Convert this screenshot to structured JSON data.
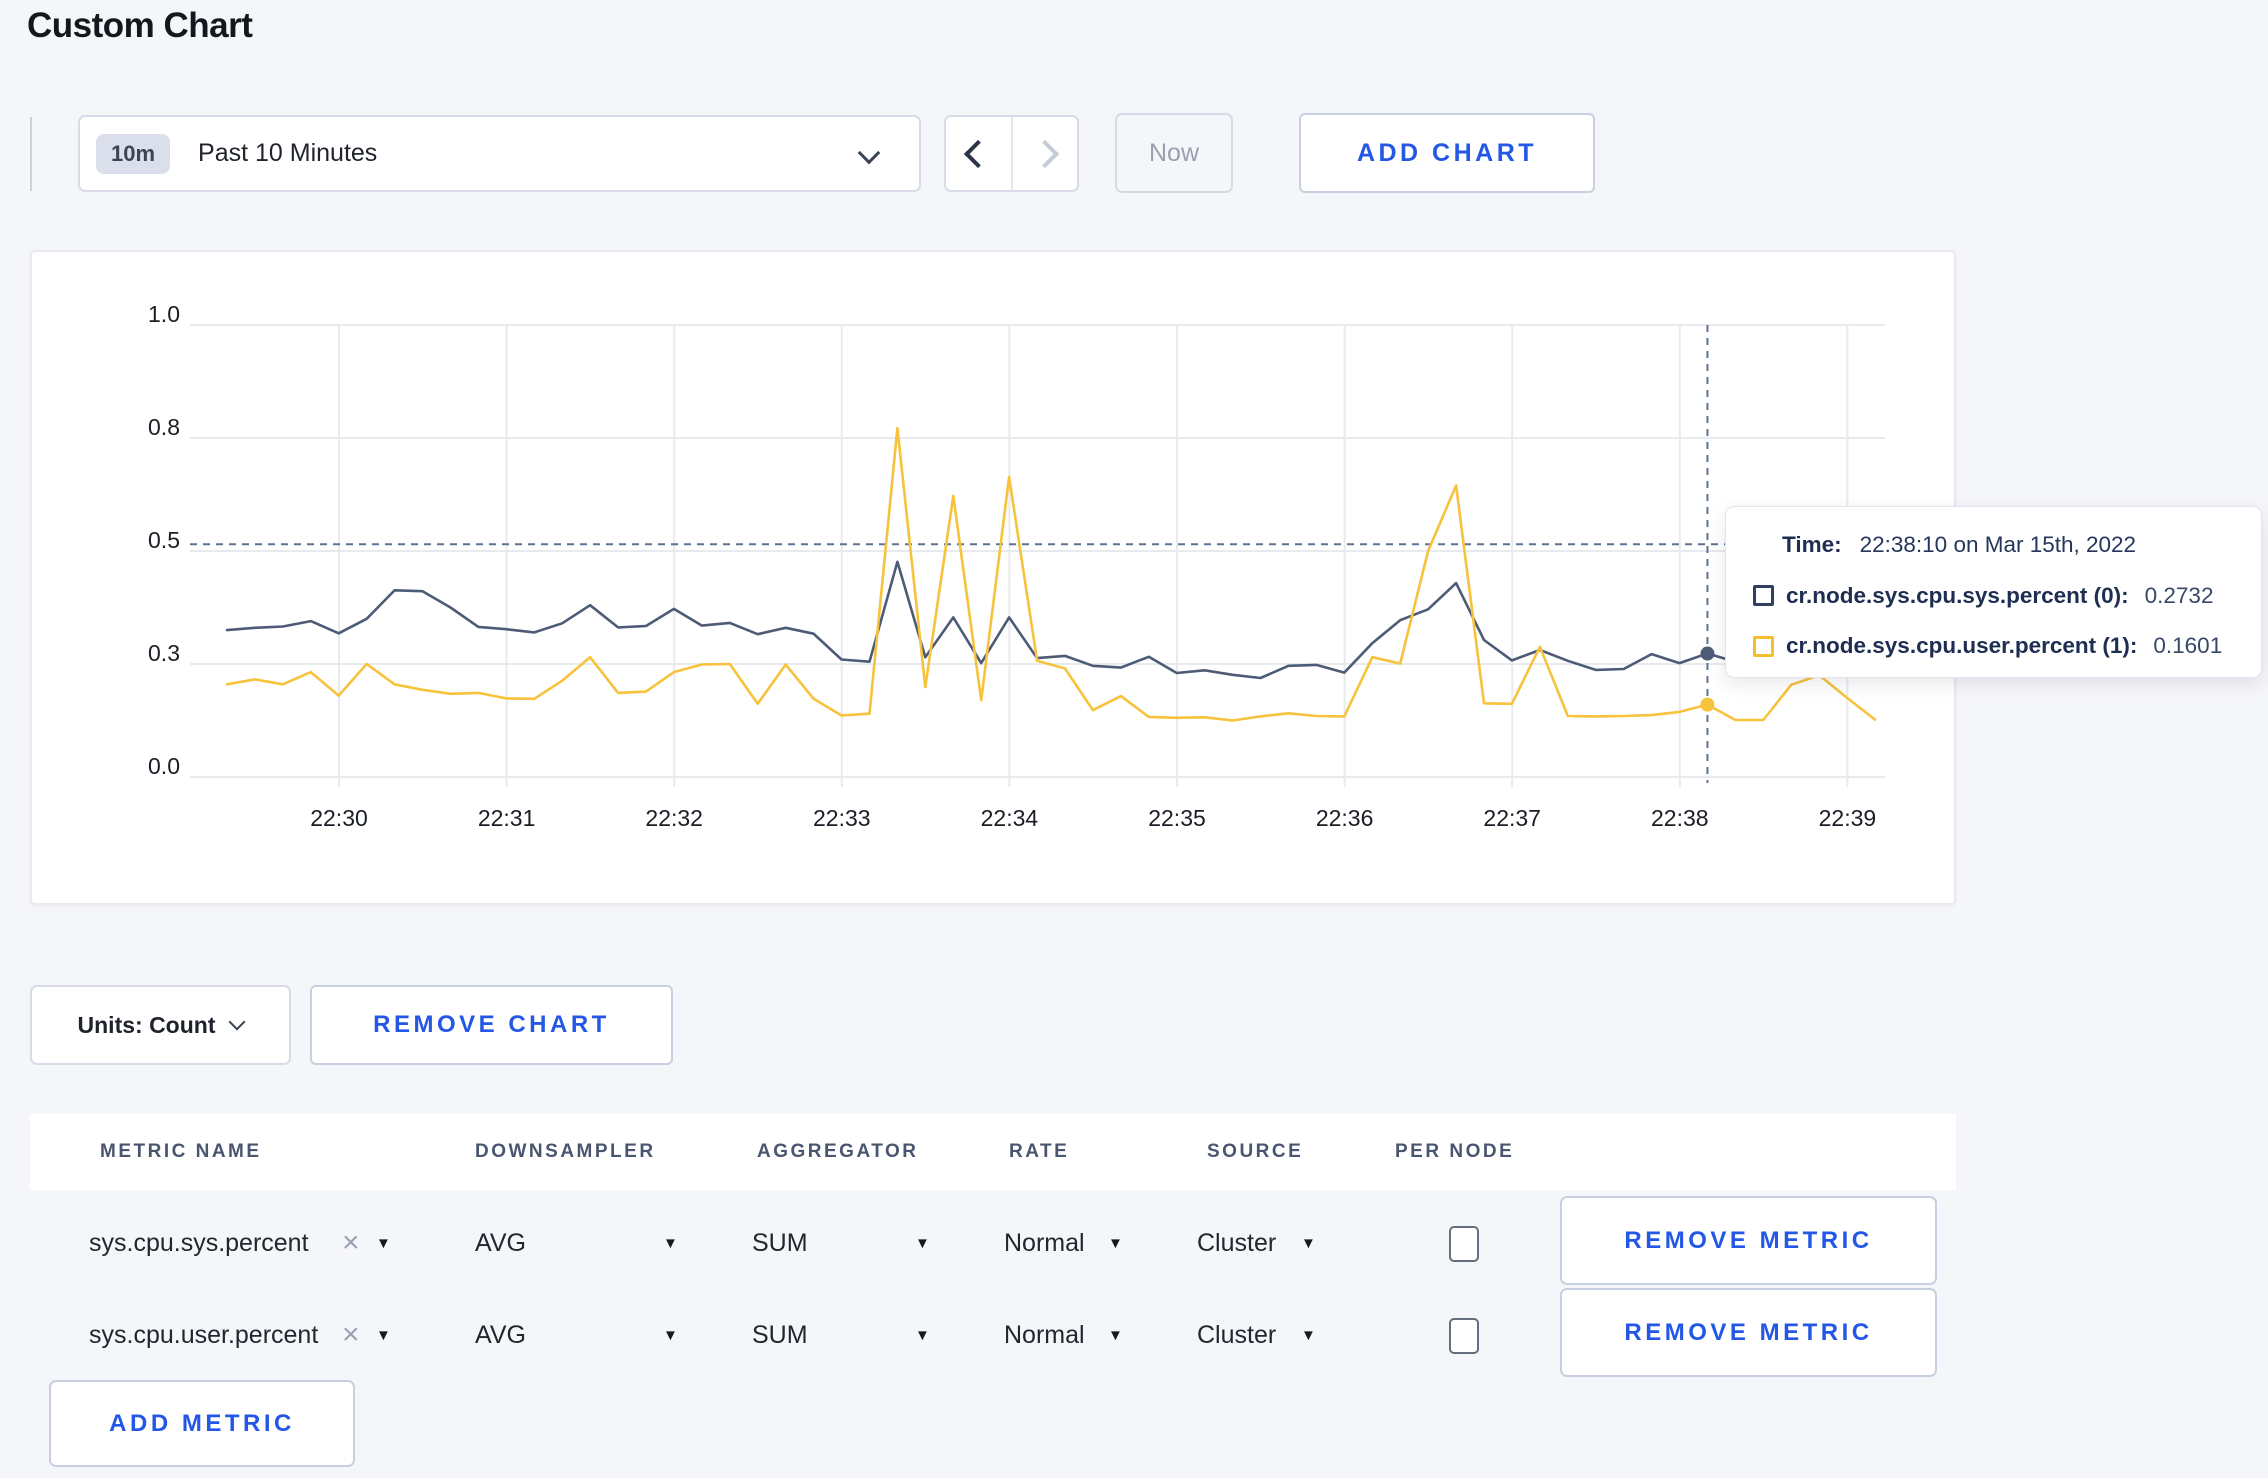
{
  "page": {
    "title": "Custom Chart"
  },
  "toolbar": {
    "range_badge": "10m",
    "range_label": "Past 10 Minutes",
    "now_label": "Now",
    "add_chart_label": "ADD CHART"
  },
  "chart_controls": {
    "units_label": "Units: Count",
    "remove_chart_label": "REMOVE CHART"
  },
  "tooltip": {
    "time_label": "Time:",
    "time_value": "22:38:10 on Mar 15th, 2022",
    "series": [
      {
        "label": "cr.node.sys.cpu.sys.percent (0):",
        "value": "0.2732",
        "color": "#31405f"
      },
      {
        "label": "cr.node.sys.cpu.user.percent (1):",
        "value": "0.1601",
        "color": "#f5bf2c"
      }
    ]
  },
  "chart_data": {
    "type": "line",
    "title": "",
    "xlabel": "",
    "ylabel": "",
    "ylim": [
      0,
      1
    ],
    "grid": true,
    "x_ticks": [
      "22:30",
      "22:31",
      "22:32",
      "22:33",
      "22:34",
      "22:35",
      "22:36",
      "22:37",
      "22:38",
      "22:39"
    ],
    "y_tick_labels": [
      "0.0",
      "0.3",
      "0.5",
      "0.8",
      "1.0"
    ],
    "y_tick_values": [
      0,
      0.25,
      0.5,
      0.75,
      1.0
    ],
    "start_time": "22:29:20",
    "sample_interval_seconds": 10,
    "hover": {
      "time": "22:38:10",
      "index": 53,
      "hline_value": 0.515
    },
    "series": [
      {
        "name": "cr.node.sys.cpu.sys.percent (0)",
        "color": "#4d5b76",
        "values": [
          0.325,
          0.33,
          0.333,
          0.345,
          0.318,
          0.35,
          0.413,
          0.411,
          0.375,
          0.332,
          0.327,
          0.32,
          0.34,
          0.38,
          0.331,
          0.334,
          0.372,
          0.335,
          0.341,
          0.316,
          0.33,
          0.317,
          0.26,
          0.255,
          0.476,
          0.265,
          0.353,
          0.252,
          0.353,
          0.263,
          0.268,
          0.246,
          0.242,
          0.266,
          0.23,
          0.236,
          0.226,
          0.219,
          0.246,
          0.248,
          0.231,
          0.296,
          0.347,
          0.371,
          0.429,
          0.303,
          0.258,
          0.281,
          0.257,
          0.237,
          0.239,
          0.272,
          0.252,
          0.2732,
          0.255,
          0.268,
          0.28,
          0.27,
          0.285,
          0.295
        ]
      },
      {
        "name": "cr.node.sys.cpu.user.percent (1)",
        "color": "#f7c23c",
        "values": [
          0.205,
          0.216,
          0.205,
          0.232,
          0.18,
          0.25,
          0.205,
          0.193,
          0.184,
          0.186,
          0.174,
          0.173,
          0.213,
          0.265,
          0.186,
          0.189,
          0.232,
          0.249,
          0.25,
          0.162,
          0.249,
          0.173,
          0.136,
          0.14,
          0.772,
          0.199,
          0.622,
          0.17,
          0.664,
          0.257,
          0.24,
          0.148,
          0.179,
          0.133,
          0.131,
          0.132,
          0.125,
          0.134,
          0.141,
          0.135,
          0.134,
          0.265,
          0.251,
          0.5,
          0.645,
          0.163,
          0.162,
          0.288,
          0.135,
          0.134,
          0.135,
          0.137,
          0.144,
          0.1601,
          0.126,
          0.126,
          0.204,
          0.225,
          0.175,
          0.127
        ]
      }
    ]
  },
  "metrics_table": {
    "headers": [
      "METRIC NAME",
      "DOWNSAMPLER",
      "AGGREGATOR",
      "RATE",
      "SOURCE",
      "PER NODE"
    ],
    "remove_metric_label": "REMOVE METRIC",
    "add_metric_label": "ADD METRIC",
    "remove_tag_glyph": "×",
    "dropdown_glyph": "▼",
    "rows": [
      {
        "metric": "sys.cpu.sys.percent",
        "downsampler": "AVG",
        "aggregator": "SUM",
        "rate": "Normal",
        "source": "Cluster",
        "per_node_checked": false
      },
      {
        "metric": "sys.cpu.user.percent",
        "downsampler": "AVG",
        "aggregator": "SUM",
        "rate": "Normal",
        "source": "Cluster",
        "per_node_checked": false
      }
    ]
  }
}
